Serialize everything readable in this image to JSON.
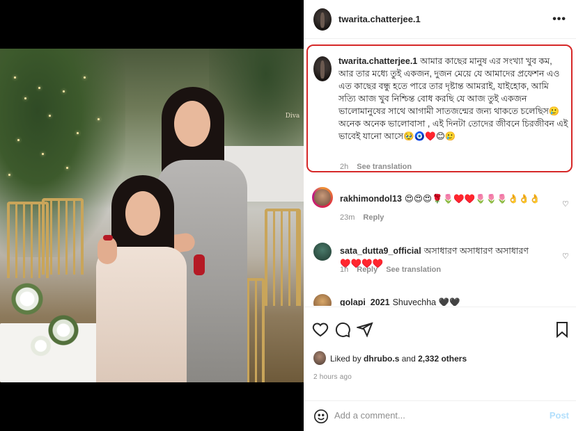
{
  "post": {
    "author": "twarita.chatterjee.1",
    "more_label": "•••"
  },
  "media": {
    "watermark_text": "Diva"
  },
  "comments": [
    {
      "user": "twarita.chatterjee.1",
      "text": "আমার কাছের মানুষ এর সংখ্যা খুব কম, আর তার মধ্যে তুই একজন, দুজন মেয়ে যে আমাদের প্রফেশন এও এত কাছের বন্ধু হতে পারে তার দৃষ্টান্ত আমরাই, যাইহোক, আমি সত্যি আজ খুব নিশ্চিন্ত বোধ করছি যে আজ তুই একজন ভালোমানুষের সাথে আগামী সাতজন্মের জন্য থাকতে চলেছিস🥲 অনেক অনেক ভালোবাসা , এই দিনটা তোদের জীবনে চিরজীবন এই ভাবেই যানো আসে🥹🧿♥️😊🥲",
      "time": "2h",
      "translate": "See translation"
    },
    {
      "user": "rakhimondol13",
      "text": "😍😍😍🌹🌷♥️♥️🌷🌷🌷👌👌👌",
      "time": "23m",
      "reply": "Reply"
    },
    {
      "user": "sata_dutta9_official",
      "text": "অসাধারণ অসাধারণ অসাধারণ ♥️♥️♥️♥️",
      "time": "1h",
      "reply": "Reply",
      "translate": "See translation"
    },
    {
      "user": "golapi_2021",
      "text": "Shuvechha 🖤🖤"
    }
  ],
  "likes": {
    "prefix": "Liked by",
    "user": "dhrubo.s",
    "middle": "and",
    "others": "2,332 others"
  },
  "timestamp": "2 hours ago",
  "add_comment": {
    "placeholder": "Add a comment...",
    "post_label": "Post"
  },
  "icons": [
    "heart-icon",
    "comment-icon",
    "share-icon",
    "bookmark-icon",
    "emoji-icon",
    "more-icon"
  ]
}
